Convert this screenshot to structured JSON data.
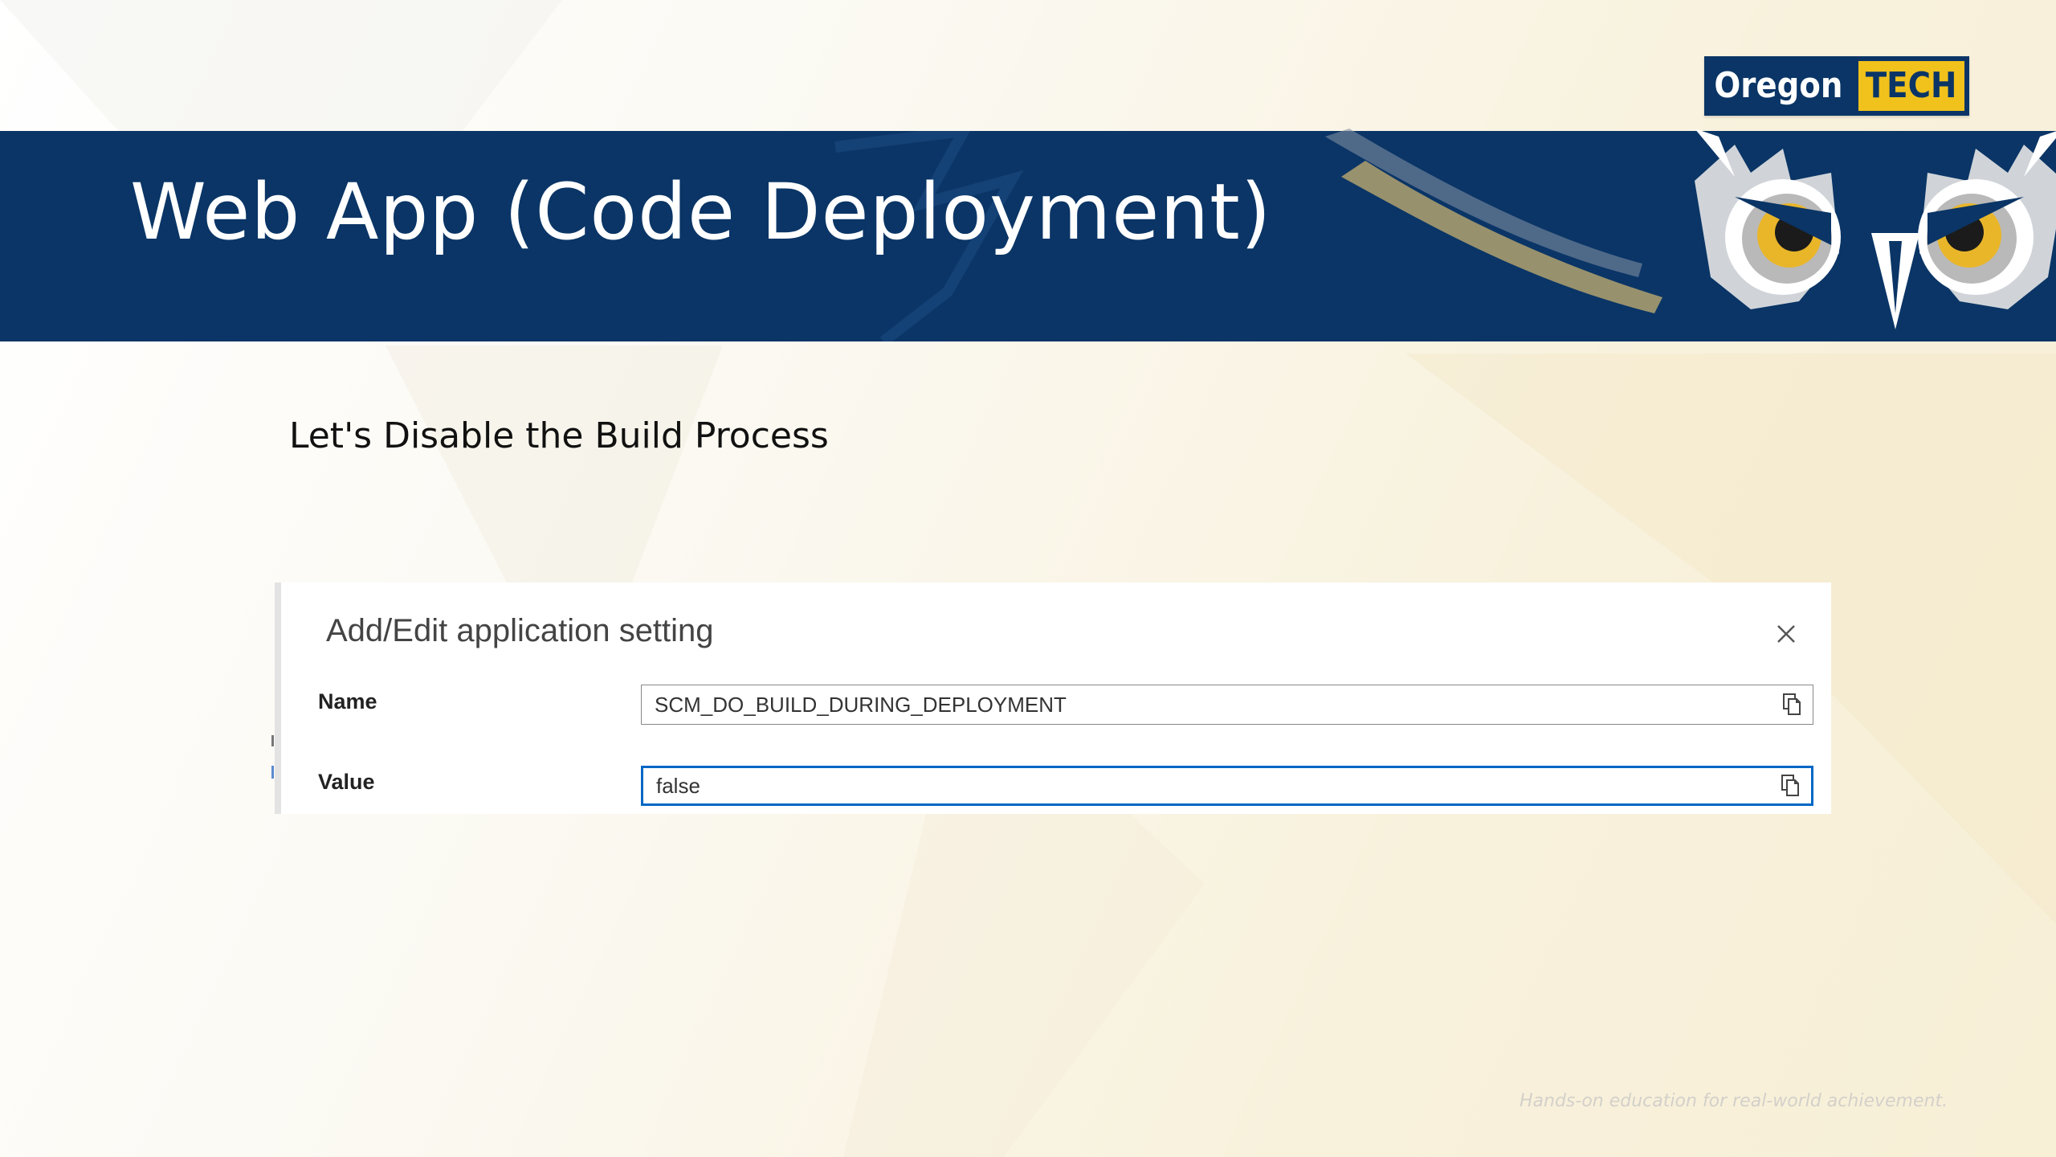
{
  "slide": {
    "title": "Web App (Code Deployment)",
    "subheading": "Let's Disable the Build Process",
    "tagline": "Hands-on education for real-world achievement."
  },
  "logo": {
    "left_text": "Oregon",
    "right_text": "TECH",
    "colors": {
      "navy": "#0a3566",
      "gold": "#f1c21b"
    }
  },
  "dialog": {
    "title": "Add/Edit application setting",
    "close_icon": "close-icon",
    "fields": [
      {
        "label": "Name",
        "value": "SCM_DO_BUILD_DURING_DEPLOYMENT",
        "focused": false,
        "icon": "copy-icon"
      },
      {
        "label": "Value",
        "value": "false",
        "focused": true,
        "icon": "copy-icon"
      }
    ]
  },
  "colors": {
    "header_band": "#0a3566",
    "focus_border": "#0067c5",
    "background_tint": "#f8f1dc"
  }
}
